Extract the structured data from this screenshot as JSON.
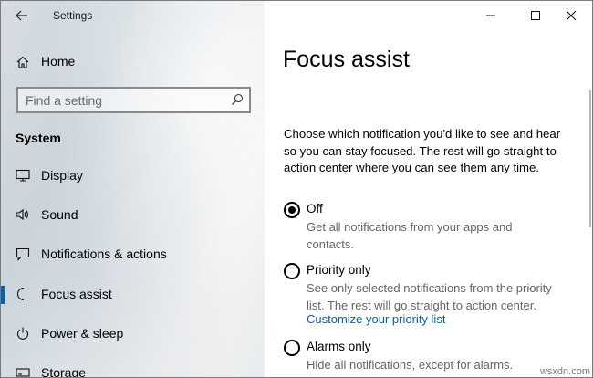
{
  "window": {
    "title": "Settings"
  },
  "sidebar": {
    "home_label": "Home",
    "search_placeholder": "Find a setting",
    "section_title": "System",
    "items": [
      {
        "label": "Display",
        "icon": "display-icon",
        "selected": false
      },
      {
        "label": "Sound",
        "icon": "speaker-icon",
        "selected": false
      },
      {
        "label": "Notifications & actions",
        "icon": "notification-icon",
        "selected": false
      },
      {
        "label": "Focus assist",
        "icon": "moon-icon",
        "selected": true
      },
      {
        "label": "Power & sleep",
        "icon": "power-icon",
        "selected": false
      },
      {
        "label": "Storage",
        "icon": "storage-icon",
        "selected": false
      }
    ]
  },
  "main": {
    "title": "Focus assist",
    "description": "Choose which notification you'd like to see and hear so you can stay focused. The rest will go straight to action center where you can see them any time.",
    "options": [
      {
        "label": "Off",
        "description": "Get all notifications from your apps and contacts.",
        "checked": true
      },
      {
        "label": "Priority only",
        "description": "See only selected notifications from the priority list. The rest will go straight to action center.",
        "link": "Customize your priority list",
        "checked": false
      },
      {
        "label": "Alarms only",
        "description": "Hide all notifications, except for alarms.",
        "checked": false
      }
    ]
  },
  "watermark": "wsxdn.com",
  "colors": {
    "accent": "#0063b1",
    "secondary_text": "#666666"
  }
}
